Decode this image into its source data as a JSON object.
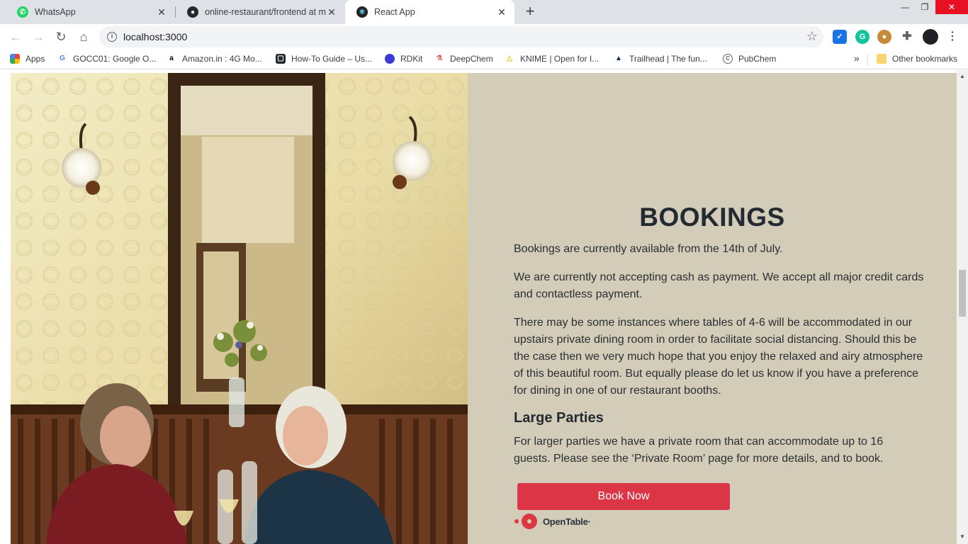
{
  "browser": {
    "tabs": [
      {
        "title": "WhatsApp",
        "icon": "whatsapp-icon",
        "color": "#25d366"
      },
      {
        "title": "online-restaurant/frontend at ma",
        "icon": "github-icon",
        "color": "#24292e"
      },
      {
        "title": "React App",
        "icon": "react-icon",
        "color": "#61dafb"
      }
    ],
    "close_glyph": "✕",
    "new_tab_glyph": "+",
    "url": "localhost:3000",
    "window_controls": {
      "minimize": "—",
      "restore": "❐",
      "close": "✕"
    }
  },
  "bookmarks": {
    "apps_label": "Apps",
    "items": [
      {
        "label": "GOCC01: Google O...",
        "icon": "google-icon"
      },
      {
        "label": "Amazon.in : 4G Mo...",
        "icon": "amazon-icon"
      },
      {
        "label": "How-To Guide – Us...",
        "icon": "guide-icon"
      },
      {
        "label": "RDKit",
        "icon": "rdkit-icon"
      },
      {
        "label": "DeepChem",
        "icon": "deepchem-icon"
      },
      {
        "label": "KNIME | Open for I...",
        "icon": "knime-icon"
      },
      {
        "label": "Trailhead | The fun...",
        "icon": "trailhead-icon"
      },
      {
        "label": "PubChem",
        "icon": "pubchem-icon"
      }
    ],
    "overflow": "»",
    "other_label": "Other bookmarks"
  },
  "page": {
    "title": "BOOKINGS",
    "paragraphs": [
      "Bookings are currently available from the 14th of July.",
      "We are currently not accepting cash as payment. We accept all major credit cards and contactless payment.",
      "There may be some instances where tables of 4-6 will be accommodated in our upstairs private dining room in order to facilitate social distancing. Should this be the case then we very much hope that you enjoy the relaxed and airy atmosphere of this beautiful room. But equally please do let us know if you have a preference for dining in one of our restaurant booths."
    ],
    "large_parties_heading": "Large Parties",
    "large_parties_text": "For larger parties we have a private room that can accommodate up to 16 guests. Please see the ‘Private Room’ page for more details, and to book.",
    "book_button": "Book Now",
    "opentable_label": "OpenTable·",
    "accent_color": "#dc3545",
    "panel_color": "#d2ccb9"
  }
}
